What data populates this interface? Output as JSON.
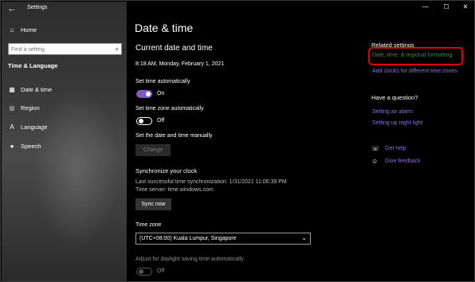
{
  "window": {
    "app_title": "Settings",
    "back_glyph": "←",
    "min_glyph": "—",
    "max_glyph": "☐",
    "close_glyph": "✕"
  },
  "sidebar": {
    "home_label": "Home",
    "search_placeholder": "Find a setting",
    "section": "Time & Language",
    "items": [
      {
        "label": "Date & time",
        "icon": "calendar-icon"
      },
      {
        "label": "Region",
        "icon": "globe-icon"
      },
      {
        "label": "Language",
        "icon": "language-icon"
      },
      {
        "label": "Speech",
        "icon": "microphone-icon"
      }
    ]
  },
  "main": {
    "title": "Date & time",
    "current_heading": "Current date and time",
    "current_value": "8:18 AM, Monday, February 1, 2021",
    "set_auto_label": "Set time automatically",
    "set_auto_state": "On",
    "set_tz_auto_label": "Set time zone automatically",
    "set_tz_auto_state": "Off",
    "manual_label": "Set the date and time manually",
    "change_button": "Change",
    "sync_heading": "Synchronize your clock",
    "last_sync": "Last successful time synchronization: 1/31/2021 11:06:39 PM",
    "time_server": "Time server: time.windows.com",
    "sync_button": "Sync now",
    "tz_label": "Time zone",
    "tz_value": "(UTC+08:00) Kuala Lumpur, Singapore",
    "dst_label": "Adjust for daylight saving time automatically",
    "dst_state": "Off"
  },
  "right": {
    "related_heading": "Related settings",
    "link_regional": "Date, time, & regional formatting",
    "link_clocks": "Add clocks for different time zones",
    "question_heading": "Have a question?",
    "link_alarm": "Setting an alarm",
    "link_nightlight": "Setting up night light",
    "get_help": "Get help",
    "give_feedback": "Give feedback"
  },
  "colors": {
    "accent": "#7b5bc6",
    "link": "#8a6fe0",
    "highlight": "#e00000"
  }
}
